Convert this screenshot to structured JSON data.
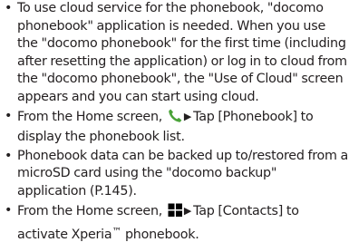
{
  "bullet_symbol": "•",
  "notes": [
    {
      "text": "To use cloud service for the phonebook, \"docomo phonebook\" application is needed. When you use the \"docomo phonebook\" for the first time (including after resetting the application) or log in to cloud from the \"docomo phonebook\", the \"Use of Cloud\" screen appears and you can start using cloud."
    },
    {
      "before_icon": "From the Home screen,",
      "icon": "phone-handset-icon",
      "arrow": "▶",
      "after_icon": "Tap [Phonebook] to display the phonebook list."
    },
    {
      "text": "Phonebook data can be backed up to/restored from a microSD card using the \"docomo backup\" application (P.145)."
    },
    {
      "before_icon": "From the Home screen,",
      "icon": "app-grid-icon",
      "arrow": "▶",
      "after_icon": "Tap [Contacts] to activate Xperia",
      "trademark": "™",
      "tail": " phonebook."
    }
  ],
  "colors": {
    "text": "#231f20",
    "phone_icon": "#4aa339",
    "grid_icon": "#000000"
  }
}
